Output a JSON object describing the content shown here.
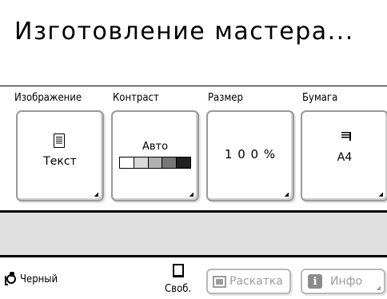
{
  "title": "Изготовление мастера...",
  "categories": {
    "image": "Изображение",
    "contrast": "Контраст",
    "size": "Размер",
    "paper": "Бумага"
  },
  "buttons": {
    "image_value": "Текст",
    "contrast_value": "Авто",
    "contrast_scale": [
      "#ffffff",
      "#d8d8d8",
      "#b0b0b0",
      "#787878",
      "#202020"
    ],
    "size_value": "1 0 0 %",
    "paper_value": "A4"
  },
  "status": {
    "ink_color": "Черный",
    "free_label": "Своб."
  },
  "bottom_buttons": {
    "proof": "Раскатка",
    "info": "Инфо"
  },
  "colors": {
    "message_area": "#e0e0e0",
    "disabled_text": "#9c9c9c",
    "info_icon_bg": "#8c8c8c"
  },
  "icons": {
    "image": "text-document-icon",
    "paper": "paper-tray-icon",
    "ink": "ink-drum-icon",
    "free": "paper-sheet-icon",
    "proof": "proof-print-icon",
    "info": "info-icon"
  }
}
